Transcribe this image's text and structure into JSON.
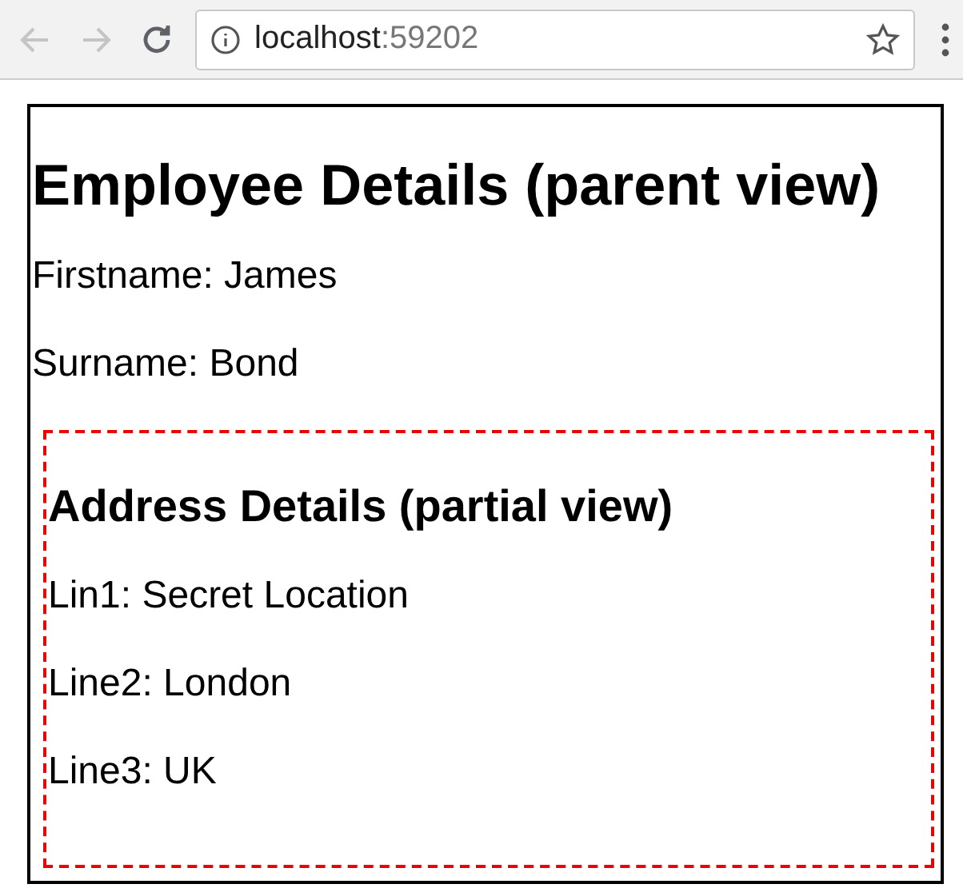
{
  "browser": {
    "back_disabled": true,
    "forward_disabled": true,
    "host": "localhost",
    "port": ":59202"
  },
  "parent": {
    "heading": "Employee Details (parent view)",
    "lines": [
      "Firstname: James",
      "Surname: Bond"
    ]
  },
  "partial": {
    "heading": "Address Details (partial view)",
    "lines": [
      "Lin1: Secret Location",
      "Line2: London",
      "Line3: UK"
    ]
  }
}
